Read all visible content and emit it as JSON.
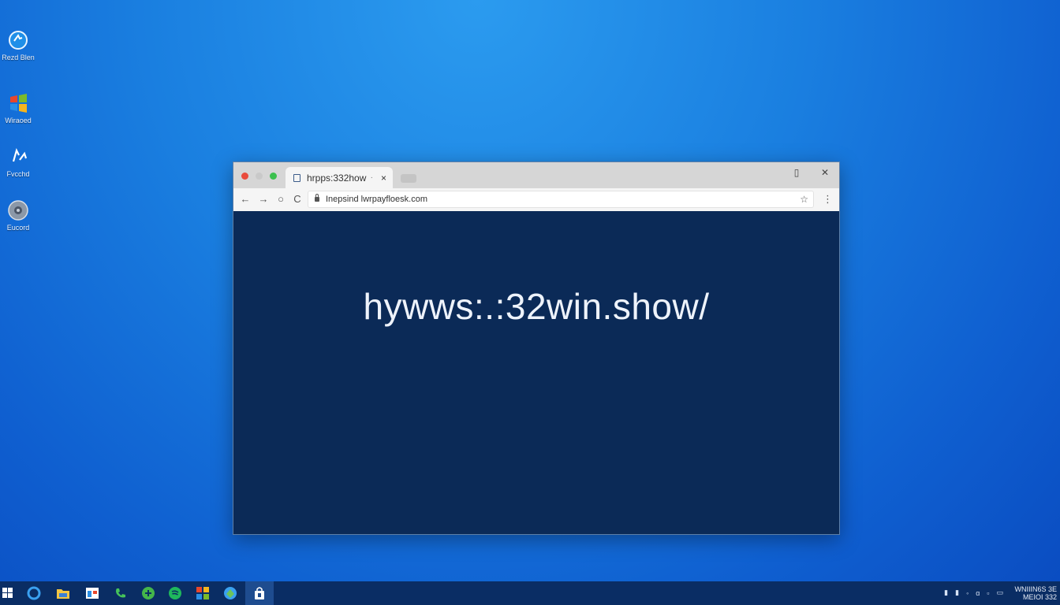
{
  "desktop": {
    "background_color": "#1a7fe0",
    "icons": [
      {
        "label": "Rezd Blen",
        "icon": "network-globe-icon"
      },
      {
        "label": "Wiraoed",
        "icon": "windows-logo-icon"
      },
      {
        "label": "Fvcchd",
        "icon": "recycle-arrows-icon"
      },
      {
        "label": "Eucord",
        "icon": "disc-drive-icon"
      }
    ]
  },
  "browser": {
    "tab": {
      "title": "hrpps:332how",
      "dot": "·",
      "close": "×"
    },
    "window_controls": {
      "restore": "▯",
      "close": "✕"
    },
    "toolbar": {
      "back": "←",
      "forward": "→",
      "stop": "○",
      "reload": "C",
      "url": "Inepsind lwrpayfloesk.com",
      "star": "☆",
      "menu": "⋮"
    },
    "content": {
      "headline": "hywws:.:32win.show/",
      "background_color": "#0b2a57"
    }
  },
  "taskbar": {
    "background_color": "#0a2d64",
    "apps": [
      {
        "name": "start",
        "icon": "windows-start-icon"
      },
      {
        "name": "edge",
        "icon": "edge-browser-icon"
      },
      {
        "name": "explorer",
        "icon": "folder-icon"
      },
      {
        "name": "store",
        "icon": "store-window-icon"
      },
      {
        "name": "phone",
        "icon": "phone-icon"
      },
      {
        "name": "xbox",
        "icon": "game-controller-icon"
      },
      {
        "name": "spotify",
        "icon": "music-icon"
      },
      {
        "name": "office",
        "icon": "office-tiles-icon"
      },
      {
        "name": "maps",
        "icon": "globe-icon"
      },
      {
        "name": "lock",
        "icon": "shopping-bag-icon"
      }
    ],
    "tray": [
      "▮",
      "▮",
      "◦",
      "ɑ",
      "▫",
      "▭"
    ],
    "clock": {
      "line1": "WNIIIN6S 3E",
      "line2": "MEIOI 332"
    }
  }
}
